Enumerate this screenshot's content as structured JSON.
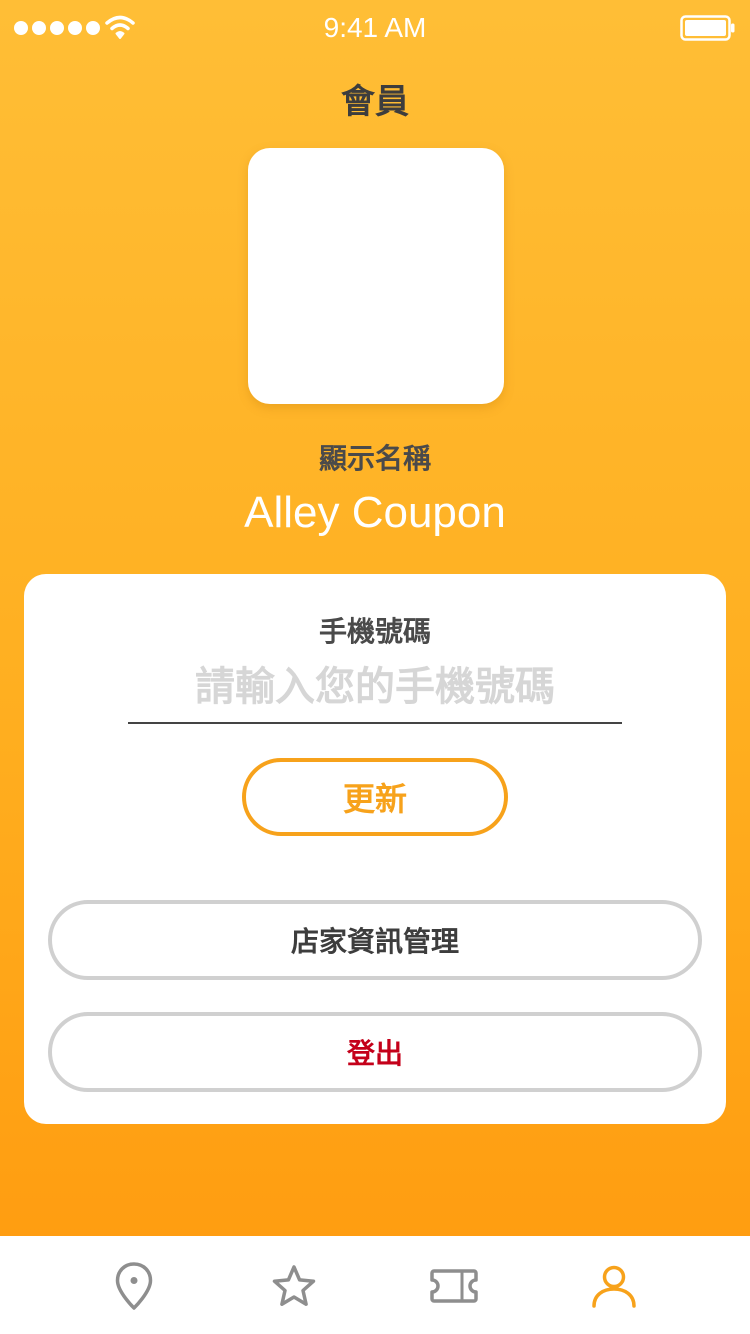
{
  "status_bar": {
    "time": "9:41 AM"
  },
  "header": {
    "title": "會員"
  },
  "profile": {
    "display_name_label": "顯示名稱",
    "display_name": "Alley Coupon"
  },
  "form": {
    "phone_label": "手機號碼",
    "phone_value": "",
    "phone_placeholder": "請輸入您的手機號碼",
    "update_label": "更新",
    "store_manage_label": "店家資訊管理",
    "logout_label": "登出"
  },
  "tab_bar": {
    "items": [
      {
        "icon": "map-pin-icon",
        "active": false
      },
      {
        "icon": "star-icon",
        "active": false
      },
      {
        "icon": "ticket-icon",
        "active": false
      },
      {
        "icon": "user-icon",
        "active": true
      }
    ]
  },
  "colors": {
    "accent": "#F7A21B",
    "background_top": "#FFBE36",
    "background_bottom": "#FF9A0E",
    "logout": "#C4001A",
    "inactive_icon": "#8e8e8e",
    "border": "#d0d0d0"
  }
}
